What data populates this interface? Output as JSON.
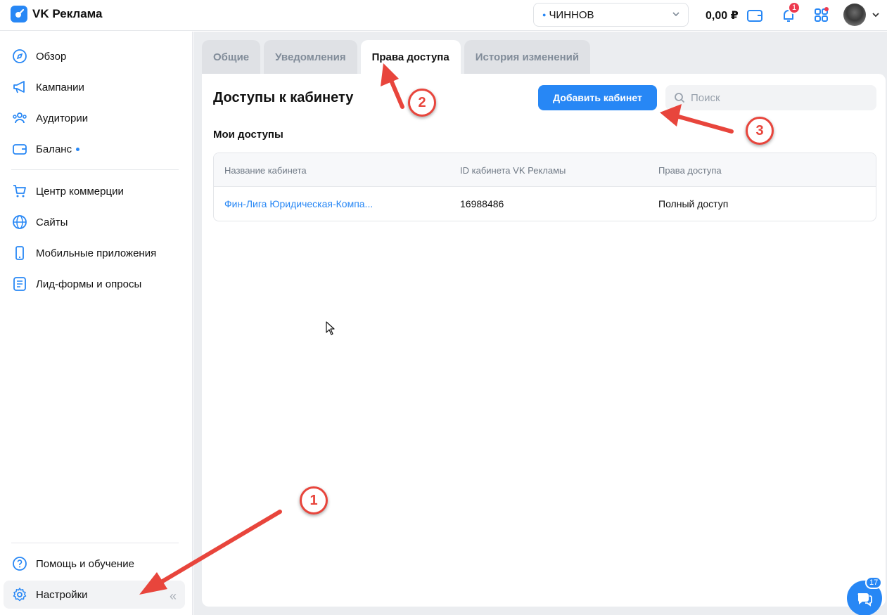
{
  "app": {
    "title": "VK Реклама"
  },
  "header": {
    "account": "ЧИННОВ",
    "balance": "0,00 ₽",
    "notifications_count": "1"
  },
  "sidebar": {
    "items": [
      {
        "label": "Обзор",
        "icon": "compass-icon"
      },
      {
        "label": "Кампании",
        "icon": "megaphone-icon"
      },
      {
        "label": "Аудитории",
        "icon": "users-icon"
      },
      {
        "label": "Баланс",
        "icon": "wallet-icon"
      },
      {
        "label": "Центр коммерции",
        "icon": "cart-icon"
      },
      {
        "label": "Сайты",
        "icon": "globe-icon"
      },
      {
        "label": "Мобильные приложения",
        "icon": "phone-icon"
      },
      {
        "label": "Лид-формы и опросы",
        "icon": "list-icon"
      }
    ],
    "bottom": [
      {
        "label": "Помощь и обучение",
        "icon": "help-icon"
      },
      {
        "label": "Настройки",
        "icon": "gear-icon"
      }
    ]
  },
  "tabs": [
    {
      "label": "Общие"
    },
    {
      "label": "Уведомления"
    },
    {
      "label": "Права доступа"
    },
    {
      "label": "История изменений"
    }
  ],
  "panel": {
    "title": "Доступы к кабинету",
    "add_button": "Добавить кабинет",
    "search_placeholder": "Поиск",
    "section_title": "Мои доступы",
    "table": {
      "headers": [
        "Название кабинета",
        "ID кабинета VK Рекламы",
        "Права доступа"
      ],
      "rows": [
        [
          "Фин-Лига Юридическая-Компа...",
          "16988486",
          "Полный доступ"
        ]
      ]
    }
  },
  "annotations": [
    "1",
    "2",
    "3"
  ],
  "chat": {
    "unread": "17"
  },
  "colors": {
    "accent": "#2787f5",
    "annotation": "#e8453c",
    "badge": "#ed3a4f"
  }
}
